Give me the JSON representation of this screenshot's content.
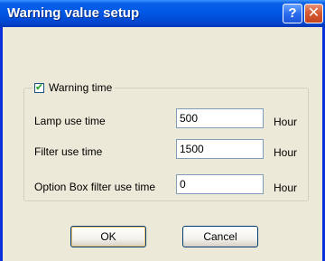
{
  "window": {
    "title": "Warning value setup",
    "help_glyph": "?",
    "close_glyph": "✕"
  },
  "group": {
    "checkbox_label": "Warning time",
    "checked": true,
    "check_glyph": "✔"
  },
  "rows": [
    {
      "label": "Lamp use time",
      "value": "500",
      "unit": "Hour"
    },
    {
      "label": "Filter use time",
      "value": "1500",
      "unit": "Hour"
    },
    {
      "label": "Option Box filter use time",
      "value": "0",
      "unit": "Hour"
    }
  ],
  "buttons": {
    "ok_label": "OK",
    "cancel_label": "Cancel"
  },
  "colors": {
    "titlebar": "#0058e6",
    "dialog_bg": "#ece9d8",
    "close_button": "#d85a33"
  }
}
